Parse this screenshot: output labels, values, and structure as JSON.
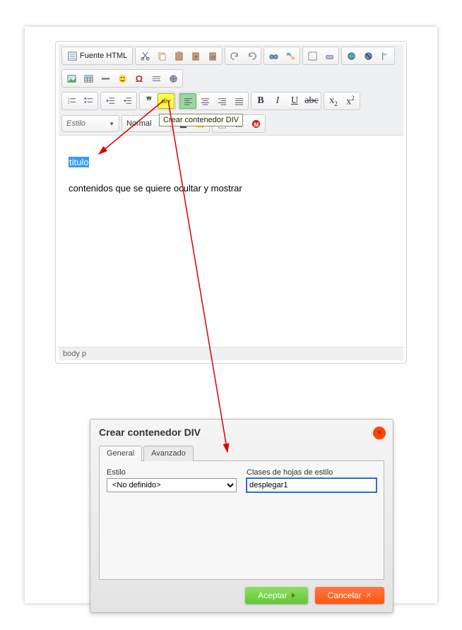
{
  "editor": {
    "source_button": "Fuente HTML",
    "style_combo": "Estilo",
    "format_combo": "Normal",
    "tooltip": "Crear contenedor DIV",
    "content": {
      "selected_text": "titulo",
      "body_text": "contenidos que se quiere ocultar y mostrar"
    },
    "status": "body  p"
  },
  "dialog": {
    "title": "Crear contenedor DIV",
    "tabs": {
      "general": "General",
      "advanced": "Avanzado"
    },
    "fields": {
      "style_label": "Estilo",
      "style_value": "<No definido>",
      "class_label": "Clases de hojas de estilo",
      "class_value": "desplegar1"
    },
    "buttons": {
      "ok": "Aceptar",
      "cancel": "Cancelar"
    }
  }
}
